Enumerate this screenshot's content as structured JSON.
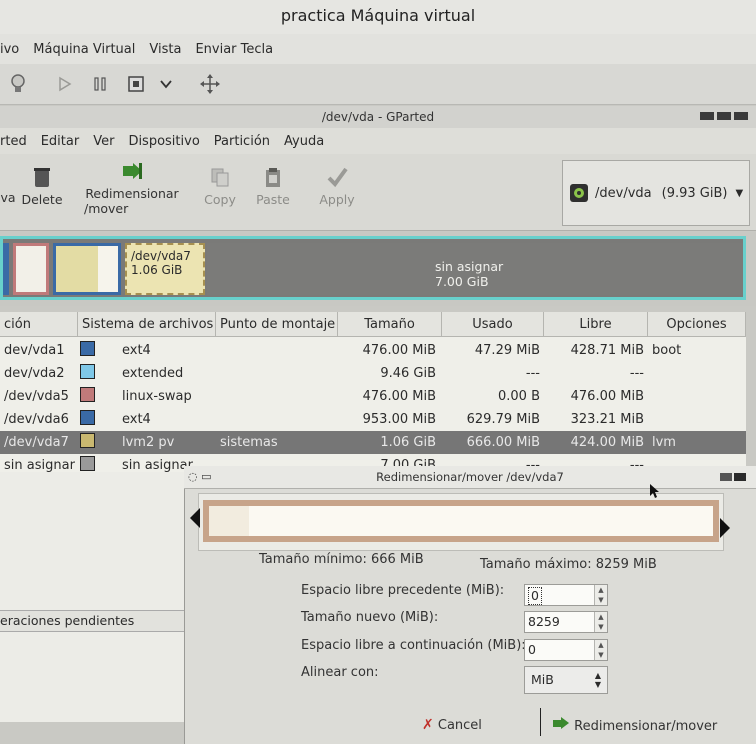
{
  "vm": {
    "title": "practica Máquina virtual",
    "menu": [
      "ivo",
      "Máquina Virtual",
      "Vista",
      "Enviar Tecla"
    ]
  },
  "gparted": {
    "title": "/dev/vda - GParted",
    "menu": [
      "rted",
      "Editar",
      "Ver",
      "Dispositivo",
      "Partición",
      "Ayuda"
    ],
    "toolbar": {
      "new_label": "va",
      "delete_label": "Delete",
      "resize_label_1": "Redimensionar",
      "resize_label_2": "/mover",
      "copy_label": "Copy",
      "paste_label": "Paste",
      "apply_label": "Apply"
    },
    "device": {
      "name": "/dev/vda",
      "size": "(9.93 GiB)"
    },
    "graph": {
      "vda7_name": "/dev/vda7",
      "vda7_size": "1.06 GiB",
      "unalloc_name": "sin asignar",
      "unalloc_size": "7.00 GiB"
    },
    "columns": [
      "ción",
      "Sistema de archivos",
      "Punto de montaje",
      "Tamaño",
      "Usado",
      "Libre",
      "Opciones"
    ],
    "rows": [
      {
        "part": "dev/vda1",
        "fs": "ext4",
        "mount": "",
        "size": "476.00 MiB",
        "used": "47.29 MiB",
        "free": "428.71 MiB",
        "flags": "boot",
        "color": "#3a6aa6"
      },
      {
        "part": "dev/vda2",
        "fs": "extended",
        "mount": "",
        "size": "9.46 GiB",
        "used": "---",
        "free": "---",
        "flags": "",
        "color": "#7fc8e8"
      },
      {
        "part": "/dev/vda5",
        "fs": "linux-swap",
        "mount": "",
        "size": "476.00 MiB",
        "used": "0.00 B",
        "free": "476.00 MiB",
        "flags": "",
        "color": "#c07a7a"
      },
      {
        "part": "/dev/vda6",
        "fs": "ext4",
        "mount": "",
        "size": "953.00 MiB",
        "used": "629.79 MiB",
        "free": "323.21 MiB",
        "flags": "",
        "color": "#3a6aa6"
      },
      {
        "part": "/dev/vda7",
        "fs": "lvm2 pv",
        "mount": "sistemas",
        "size": "1.06 GiB",
        "used": "666.00 MiB",
        "free": "424.00 MiB",
        "flags": "lvm",
        "color": "#c9b870"
      },
      {
        "part": "sin asignar",
        "fs": "sin asignar",
        "mount": "",
        "size": "7.00 GiB",
        "used": "---",
        "free": "---",
        "flags": "",
        "color": "#9a9a9a"
      }
    ],
    "pending_label": "eraciones pendientes"
  },
  "dialog": {
    "title": "Redimensionar/mover /dev/vda7",
    "min_size": "Tamaño mínimo: 666 MiB",
    "max_size": "Tamaño máximo: 8259 MiB",
    "free_before_label": "Espacio libre precedente (MiB):",
    "free_before_value": "0",
    "new_size_label": "Tamaño nuevo (MiB):",
    "new_size_value": "8259",
    "free_after_label": "Espacio libre a continuación (MiB):",
    "free_after_value": "0",
    "align_label": "Alinear con:",
    "align_value": "MiB",
    "cancel_label": "Cancel",
    "resize_label": "Redimensionar/mover"
  },
  "colors": {
    "accent_cyan": "#68d0cc",
    "selection": "#767676",
    "lvm": "#c9b870"
  }
}
